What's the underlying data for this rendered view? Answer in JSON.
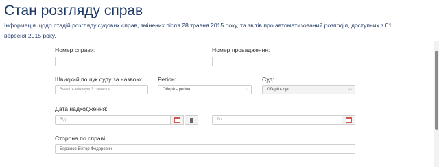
{
  "page": {
    "title": "Стан розгляду справ",
    "intro": "Інформація щодо стадій розгляду судових справ, змінених після 28 травня 2015 року, та звітів про автоматизований розподіл, доступних з 01 вересня 2015 року."
  },
  "form": {
    "case_number": {
      "label": "Номер справи:",
      "value": ""
    },
    "proceeding_number": {
      "label": "Номер провадження:",
      "value": ""
    },
    "court_search": {
      "label": "Швидкий пошук суду за назвою:",
      "placeholder": "Введіть мінімум 3 символи"
    },
    "region": {
      "label": "Регіон:",
      "selected": "Оберіть регіон"
    },
    "court": {
      "label": "Суд:",
      "selected": "Оберіть суд"
    },
    "receipt_date": {
      "label": "Дата надходження:",
      "from_placeholder": "Від",
      "to_placeholder": "До"
    },
    "party": {
      "label": "Сторона по справі:",
      "value": "Борзілов Віктор Федорович"
    }
  },
  "icons": {
    "calendar": "calendar-icon",
    "clear": "trash-icon",
    "dropdown": "chevron-down-icon"
  },
  "colors": {
    "title": "#1e3866",
    "calendar_accent": "#d0574f"
  }
}
